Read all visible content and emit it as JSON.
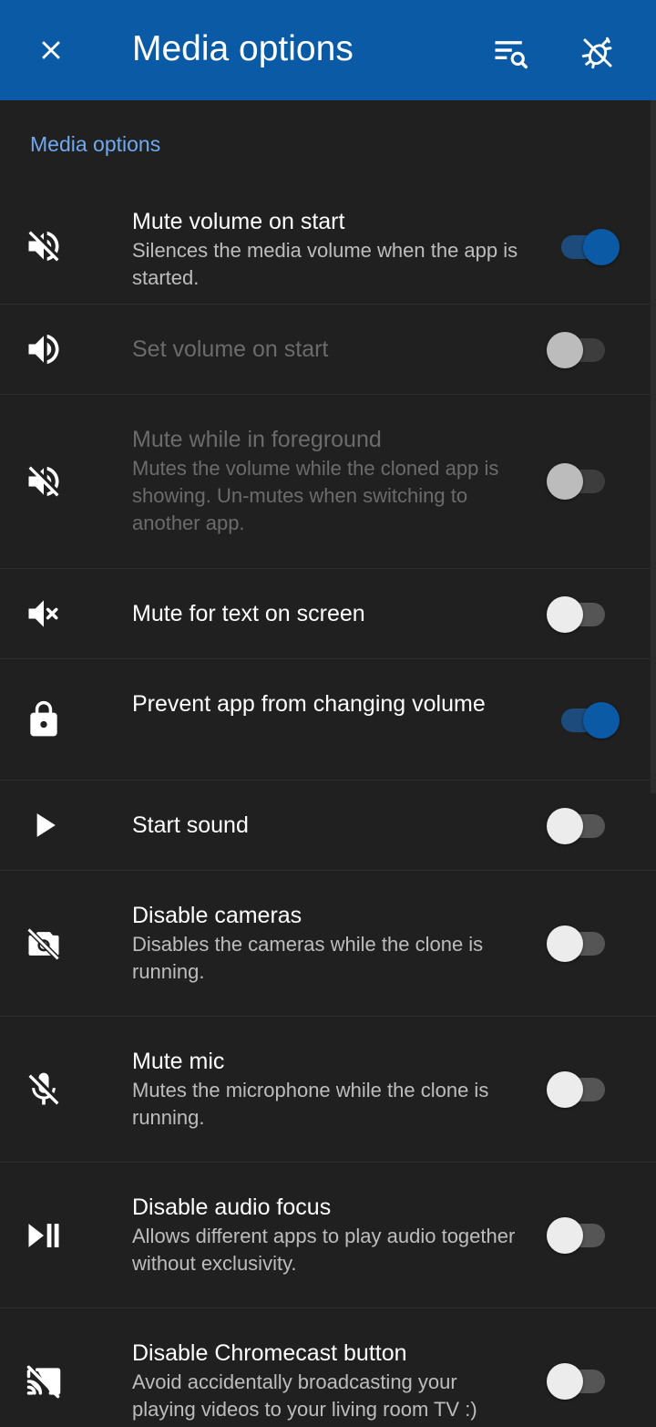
{
  "appbar": {
    "title": "Media options",
    "close_icon": "close-icon",
    "search_icon": "filter-search-icon",
    "debug_icon": "bug-icon",
    "background": "#0b5aa5"
  },
  "section": {
    "title": "Media options",
    "accent": "#6fa9f0"
  },
  "settings": [
    {
      "label": "Mute volume on start",
      "desc": "Silences the media volume when the app is started.",
      "icon": "volume-off-icon",
      "enabled": true,
      "checked": true
    },
    {
      "label": "Set volume on start",
      "desc": "",
      "icon": "volume-up-icon",
      "enabled": false,
      "checked": false
    },
    {
      "label": "Mute while in foreground",
      "desc": "Mutes the volume while the cloned app is showing. Un-mutes when switching to another app.",
      "icon": "volume-off-icon",
      "enabled": false,
      "checked": false
    },
    {
      "label": "Mute for text on screen",
      "desc": "",
      "icon": "volume-mute-x-icon",
      "enabled": true,
      "checked": false
    },
    {
      "label": "Prevent app from changing volume",
      "desc": "",
      "icon": "lock-icon",
      "enabled": true,
      "checked": true
    },
    {
      "label": "Start sound",
      "desc": "",
      "icon": "play-icon",
      "enabled": true,
      "checked": false
    },
    {
      "label": "Disable cameras",
      "desc": "Disables the cameras while the clone is running.",
      "icon": "camera-off-icon",
      "enabled": true,
      "checked": false
    },
    {
      "label": "Mute mic",
      "desc": "Mutes the microphone while the clone is running.",
      "icon": "mic-off-icon",
      "enabled": true,
      "checked": false
    },
    {
      "label": "Disable audio focus",
      "desc": "Allows different apps to play audio together without exclusivity.",
      "icon": "play-pause-icon",
      "enabled": true,
      "checked": false
    },
    {
      "label": "Disable Chromecast button",
      "desc": "Avoid accidentally broadcasting your playing videos to your living room TV :)",
      "icon": "cast-off-icon",
      "enabled": true,
      "checked": false
    }
  ]
}
